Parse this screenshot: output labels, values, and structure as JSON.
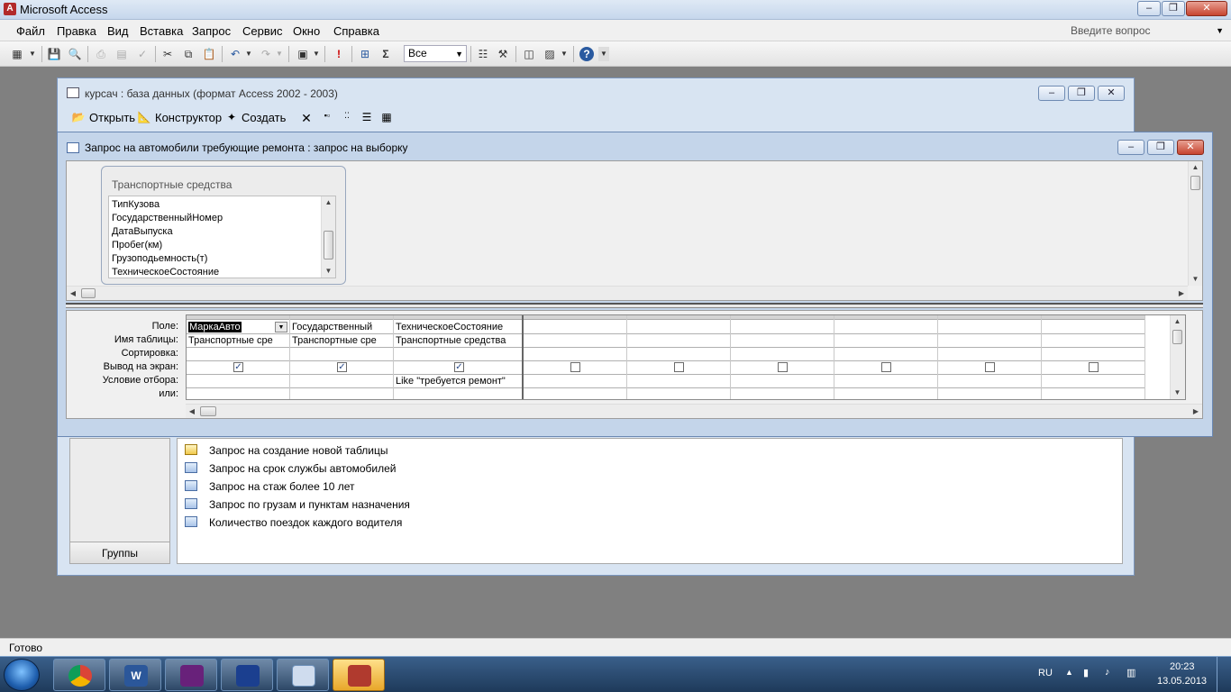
{
  "app": {
    "title": "Microsoft Access",
    "icon": "access-app-icon"
  },
  "menu": [
    "Файл",
    "Правка",
    "Вид",
    "Вставка",
    "Запрос",
    "Сервис",
    "Окно",
    "Справка"
  ],
  "ask": {
    "placeholder": "Введите вопрос"
  },
  "toolbar": {
    "filter_value": "Все"
  },
  "db_window": {
    "title": "курсач : база данных (формат Access 2002 - 2003)",
    "open_label": "Открыть",
    "design_label": "Конструктор",
    "create_label": "Создать",
    "groups_label": "Группы",
    "queries": [
      {
        "label": "Запрос на создание новой таблицы",
        "icon": "make-table-query-icon"
      },
      {
        "label": "Запрос на срок службы автомобилей",
        "icon": "select-query-icon"
      },
      {
        "label": "Запрос на стаж более 10 лет",
        "icon": "select-query-icon"
      },
      {
        "label": "Запрос по грузам и пунктам назначения",
        "icon": "select-query-icon"
      },
      {
        "label": "Количество поездок каждого водителя",
        "icon": "select-query-icon"
      }
    ]
  },
  "query_window": {
    "title": "Запрос на автомобили требующие ремонта : запрос на выборку",
    "table": {
      "name": "Транспортные средства",
      "fields": [
        "ТипКузова",
        "ГосударственныйНомер",
        "ДатаВыпуска",
        "Пробег(км)",
        "Грузоподьемность(т)",
        "ТехническоеСостояние"
      ]
    },
    "row_labels": [
      "Поле:",
      "Имя таблицы:",
      "Сортировка:",
      "Вывод на экран:",
      "Условие отбора:",
      "или:"
    ],
    "columns": [
      {
        "field": "МаркаАвто",
        "table": "Транспортные сре",
        "show": true,
        "criteria": ""
      },
      {
        "field": "Государственный",
        "table": "Транспортные сре",
        "show": true,
        "criteria": ""
      },
      {
        "field": "ТехническоеСостояние",
        "table": "Транспортные средства",
        "show": true,
        "criteria": "Like \"требуется ремонт\""
      },
      {
        "field": "",
        "table": "",
        "show": false,
        "criteria": ""
      },
      {
        "field": "",
        "table": "",
        "show": false,
        "criteria": ""
      },
      {
        "field": "",
        "table": "",
        "show": false,
        "criteria": ""
      },
      {
        "field": "",
        "table": "",
        "show": false,
        "criteria": ""
      },
      {
        "field": "",
        "table": "",
        "show": false,
        "criteria": ""
      },
      {
        "field": "",
        "table": "",
        "show": false,
        "criteria": ""
      }
    ]
  },
  "status": {
    "text": "Готово"
  },
  "taskbar": {
    "apps": [
      "chrome-icon",
      "word-icon",
      "visual-studio-icon",
      "save-icon",
      "windows-explorer-icon",
      "access-icon"
    ],
    "lang": "RU",
    "time": "20:23",
    "date": "13.05.2013"
  }
}
